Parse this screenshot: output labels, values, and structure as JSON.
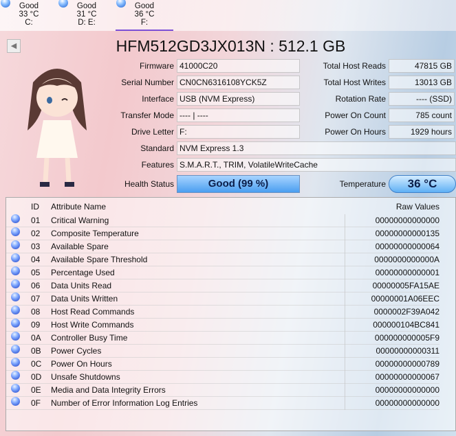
{
  "drives": [
    {
      "status": "Good",
      "temp": "33 °C",
      "letter": "C:"
    },
    {
      "status": "Good",
      "temp": "31 °C",
      "letter": "D: E:"
    },
    {
      "status": "Good",
      "temp": "36 °C",
      "letter": "F:"
    }
  ],
  "back_icon": "◀",
  "title": "HFM512GD3JX013N : 512.1 GB",
  "info": {
    "firmware_label": "Firmware",
    "firmware": "41000C20",
    "serial_label": "Serial Number",
    "serial": "CN0CN6316108YCK5Z",
    "interface_label": "Interface",
    "interface": "USB (NVM Express)",
    "transfer_label": "Transfer Mode",
    "transfer": "---- | ----",
    "letter_label": "Drive Letter",
    "letter": "F:",
    "standard_label": "Standard",
    "standard": "NVM Express 1.3",
    "features_label": "Features",
    "features": "S.M.A.R.T., TRIM, VolatileWriteCache",
    "health_label": "Health Status",
    "health": "Good  (99 %)",
    "reads_label": "Total Host Reads",
    "reads": "47815 GB",
    "writes_label": "Total Host Writes",
    "writes": "13013 GB",
    "rotation_label": "Rotation Rate",
    "rotation": "---- (SSD)",
    "count_label": "Power On Count",
    "count": "785 count",
    "hours_label": "Power On Hours",
    "hours": "1929 hours",
    "temp_label": "Temperature",
    "temp": "36 °C"
  },
  "table": {
    "headers": {
      "id": "ID",
      "name": "Attribute Name",
      "raw": "Raw Values"
    },
    "rows": [
      {
        "id": "01",
        "name": "Critical Warning",
        "raw": "00000000000000"
      },
      {
        "id": "02",
        "name": "Composite Temperature",
        "raw": "00000000000135"
      },
      {
        "id": "03",
        "name": "Available Spare",
        "raw": "00000000000064"
      },
      {
        "id": "04",
        "name": "Available Spare Threshold",
        "raw": "0000000000000A"
      },
      {
        "id": "05",
        "name": "Percentage Used",
        "raw": "00000000000001"
      },
      {
        "id": "06",
        "name": "Data Units Read",
        "raw": "00000005FA15AE"
      },
      {
        "id": "07",
        "name": "Data Units Written",
        "raw": "00000001A06EEC"
      },
      {
        "id": "08",
        "name": "Host Read Commands",
        "raw": "0000002F39A042"
      },
      {
        "id": "09",
        "name": "Host Write Commands",
        "raw": "000000104BC841"
      },
      {
        "id": "0A",
        "name": "Controller Busy Time",
        "raw": "000000000005F9"
      },
      {
        "id": "0B",
        "name": "Power Cycles",
        "raw": "00000000000311"
      },
      {
        "id": "0C",
        "name": "Power On Hours",
        "raw": "00000000000789"
      },
      {
        "id": "0D",
        "name": "Unsafe Shutdowns",
        "raw": "00000000000067"
      },
      {
        "id": "0E",
        "name": "Media and Data Integrity Errors",
        "raw": "00000000000000"
      },
      {
        "id": "0F",
        "name": "Number of Error Information Log Entries",
        "raw": "00000000000000"
      }
    ]
  }
}
